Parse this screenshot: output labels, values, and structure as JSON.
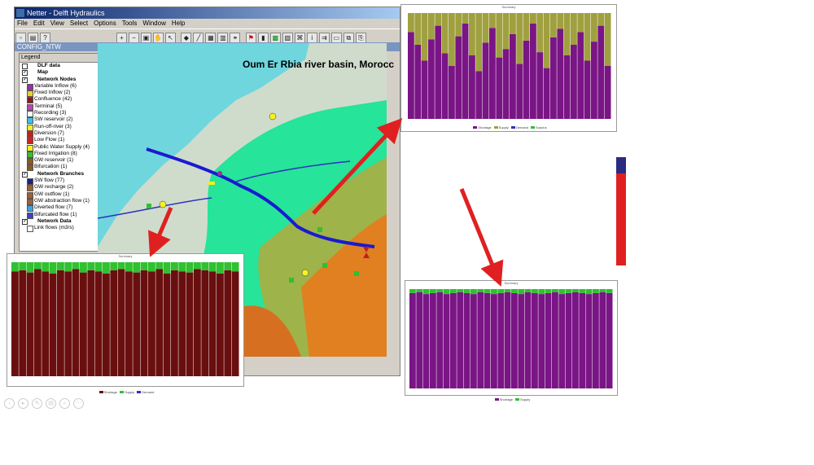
{
  "window": {
    "title": "Netter - Delft Hydraulics",
    "document_title": "CONFIG_NTW"
  },
  "menu": [
    "File",
    "Edit",
    "View",
    "Select",
    "Options",
    "Tools",
    "Window",
    "Help"
  ],
  "legend": {
    "header": "Legend",
    "sections": [
      {
        "label": "DLF data",
        "checked": false,
        "items": []
      },
      {
        "label": "Map",
        "checked": true,
        "items": []
      },
      {
        "label": "Network Nodes",
        "checked": true,
        "items": [
          {
            "label": "Variable Inflow (6)",
            "color": "#9a2fa0"
          },
          {
            "label": "Fixed Inflow (2)",
            "color": "#e8d030"
          },
          {
            "label": "Confluence (42)",
            "color": "#8b1a1a"
          },
          {
            "label": "Terminal (5)",
            "color": "#c040c0"
          },
          {
            "label": "Recording (3)",
            "color": "#ffffff"
          },
          {
            "label": "SW reservoir (2)",
            "color": "#40c0e0"
          },
          {
            "label": "Run-off-river (3)",
            "color": "#f0f020"
          },
          {
            "label": "Diversion (7)",
            "color": "#c02020"
          },
          {
            "label": "Low Flow (1)",
            "color": "#d02020"
          },
          {
            "label": "Public Water Supply (4)",
            "color": "#f8f020"
          },
          {
            "label": "Fixed Irrigation (8)",
            "color": "#30c030"
          },
          {
            "label": "GW reservoir (1)",
            "color": "#8b5a20"
          },
          {
            "label": "Bifurcation (1)",
            "color": "#8b5a20"
          }
        ]
      },
      {
        "label": "Network Branches",
        "checked": true,
        "items": [
          {
            "label": "SW flow (77)",
            "color": "#202080"
          },
          {
            "label": "GW recharge (2)",
            "color": "#a06030"
          },
          {
            "label": "GW outflow (1)",
            "color": "#a06030"
          },
          {
            "label": "GW abstraction flow (1)",
            "color": "#a06030"
          },
          {
            "label": "Diverted flow (7)",
            "color": "#40a0e0"
          },
          {
            "label": "Bifurcated flow (1)",
            "color": "#4040c0"
          }
        ]
      },
      {
        "label": "Network Data",
        "checked": true,
        "items": [
          {
            "label": "Link flows (m3/s)",
            "color": "#ffffff"
          }
        ]
      }
    ]
  },
  "map": {
    "caption": "Oum Er Rbia river basin, Morocc"
  },
  "charts": {
    "top_right": {
      "title": "Summary",
      "legend": [
        "Shortage",
        "Supply",
        "Demand",
        "Surplus"
      ],
      "colors": {
        "main": "#7a1585",
        "top": "#a0a040"
      }
    },
    "bottom_left": {
      "title": "Summary",
      "legend": [
        "Shortage",
        "Supply",
        "Demand"
      ],
      "colors": {
        "main": "#6a0f0f",
        "top": "#30c030"
      }
    },
    "bottom_right": {
      "title": "Summary",
      "legend": [
        "Shortage",
        "Supply"
      ],
      "colors": {
        "main": "#7a1585",
        "top": "#30c030"
      }
    }
  },
  "chart_data": [
    {
      "type": "bar",
      "title": "",
      "series": [
        {
          "values": [
            0.82,
            0.7,
            0.55,
            0.75,
            0.88,
            0.62,
            0.5,
            0.78,
            0.9,
            0.6,
            0.45,
            0.72,
            0.86,
            0.58,
            0.66,
            0.8,
            0.52,
            0.74,
            0.9,
            0.63,
            0.48,
            0.77,
            0.85,
            0.6,
            0.7,
            0.82,
            0.55,
            0.73,
            0.88,
            0.5
          ]
        }
      ]
    },
    {
      "type": "bar",
      "title": "",
      "series": [
        {
          "values": [
            0.92,
            0.93,
            0.91,
            0.94,
            0.92,
            0.9,
            0.93,
            0.92,
            0.94,
            0.91,
            0.93,
            0.92,
            0.9,
            0.93,
            0.94,
            0.92,
            0.91,
            0.93,
            0.92,
            0.94,
            0.9,
            0.93,
            0.92,
            0.91,
            0.94,
            0.93,
            0.92,
            0.9,
            0.93,
            0.92
          ]
        }
      ]
    },
    {
      "type": "bar",
      "title": "",
      "series": [
        {
          "values": [
            0.96,
            0.97,
            0.95,
            0.96,
            0.97,
            0.95,
            0.96,
            0.97,
            0.96,
            0.95,
            0.97,
            0.96,
            0.95,
            0.96,
            0.97,
            0.96,
            0.95,
            0.97,
            0.96,
            0.95,
            0.96,
            0.97,
            0.95,
            0.96,
            0.97,
            0.96,
            0.95,
            0.96,
            0.97,
            0.96
          ]
        }
      ]
    }
  ]
}
